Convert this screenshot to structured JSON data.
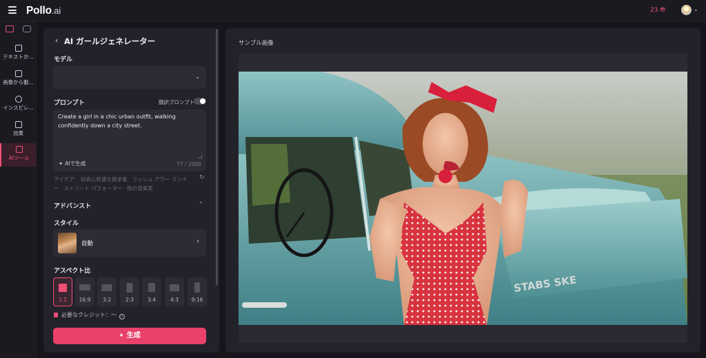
{
  "header": {
    "logo_main": "Pollo",
    "logo_suffix": ".ai",
    "credits": "23 ⛃"
  },
  "rail": {
    "items": [
      {
        "label": "テキストか..."
      },
      {
        "label": "画像から動..."
      },
      {
        "label": "インスピレ..."
      },
      {
        "label": "効果"
      },
      {
        "label": "AIツール"
      }
    ]
  },
  "panel": {
    "title": "AI ガールジェネレーター",
    "model_label": "モデル",
    "model_value": "",
    "prompt_label": "プロンプト",
    "translate_label": "翻訳プロンプト",
    "translate_on": false,
    "prompt_text": "Create a girl in a chic urban outfit, walking confidently down a city street.",
    "ai_generate": "AIで生成",
    "char_count": "77 / 2000",
    "ideas_prefix": "アイデア:",
    "ideas": [
      "好奇心旺盛な探求者",
      "ラッシュ アワー ランナー",
      "ストリート パフォーマー",
      "街の音楽家"
    ],
    "advanced_label": "アドバンスト",
    "style_label": "スタイル",
    "style_value": "自動",
    "aspect_label": "アスペクト比",
    "aspects": [
      {
        "label": "1:1",
        "active": true
      },
      {
        "label": "16:9",
        "active": false
      },
      {
        "label": "3:2",
        "active": false
      },
      {
        "label": "2:3",
        "active": false
      },
      {
        "label": "3:4",
        "active": false
      },
      {
        "label": "4:3",
        "active": false
      },
      {
        "label": "9:16",
        "active": false
      }
    ],
    "credits_needed": "必要なクレジット：～",
    "generate_label": "生成"
  },
  "preview": {
    "label": "サンプル画像",
    "car_badge": "STABS SKE"
  },
  "colors": {
    "accent": "#e8416a",
    "accent_text": "#ef4f78",
    "background": "#16151c",
    "panel": "#23222a"
  }
}
